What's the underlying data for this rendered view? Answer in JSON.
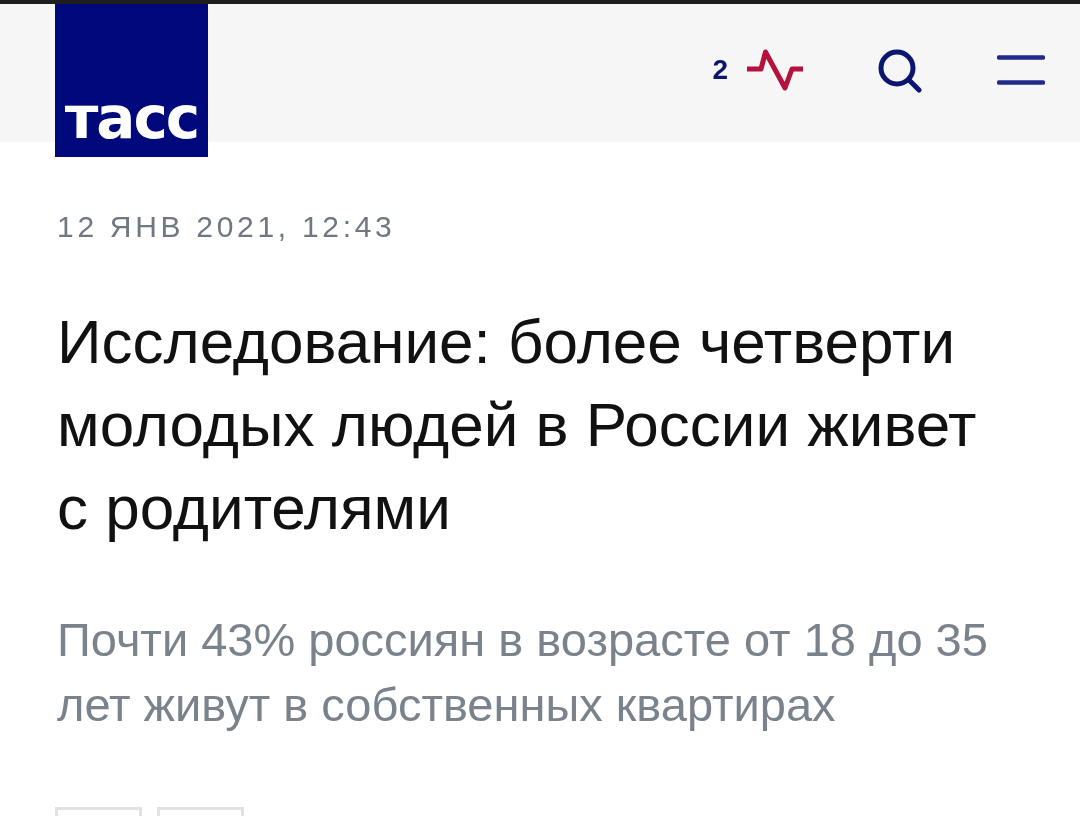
{
  "header": {
    "logo": {
      "text": "тасс"
    },
    "live_counter": "2"
  },
  "article": {
    "date": "12 ЯНВ 2021, 12:43",
    "title": "Исследование: более четверти молодых людей в России живет с родителями",
    "lead": "Почти 43% россиян в возрасте от 18 до 35 лет живут в собственных квартирах"
  }
}
